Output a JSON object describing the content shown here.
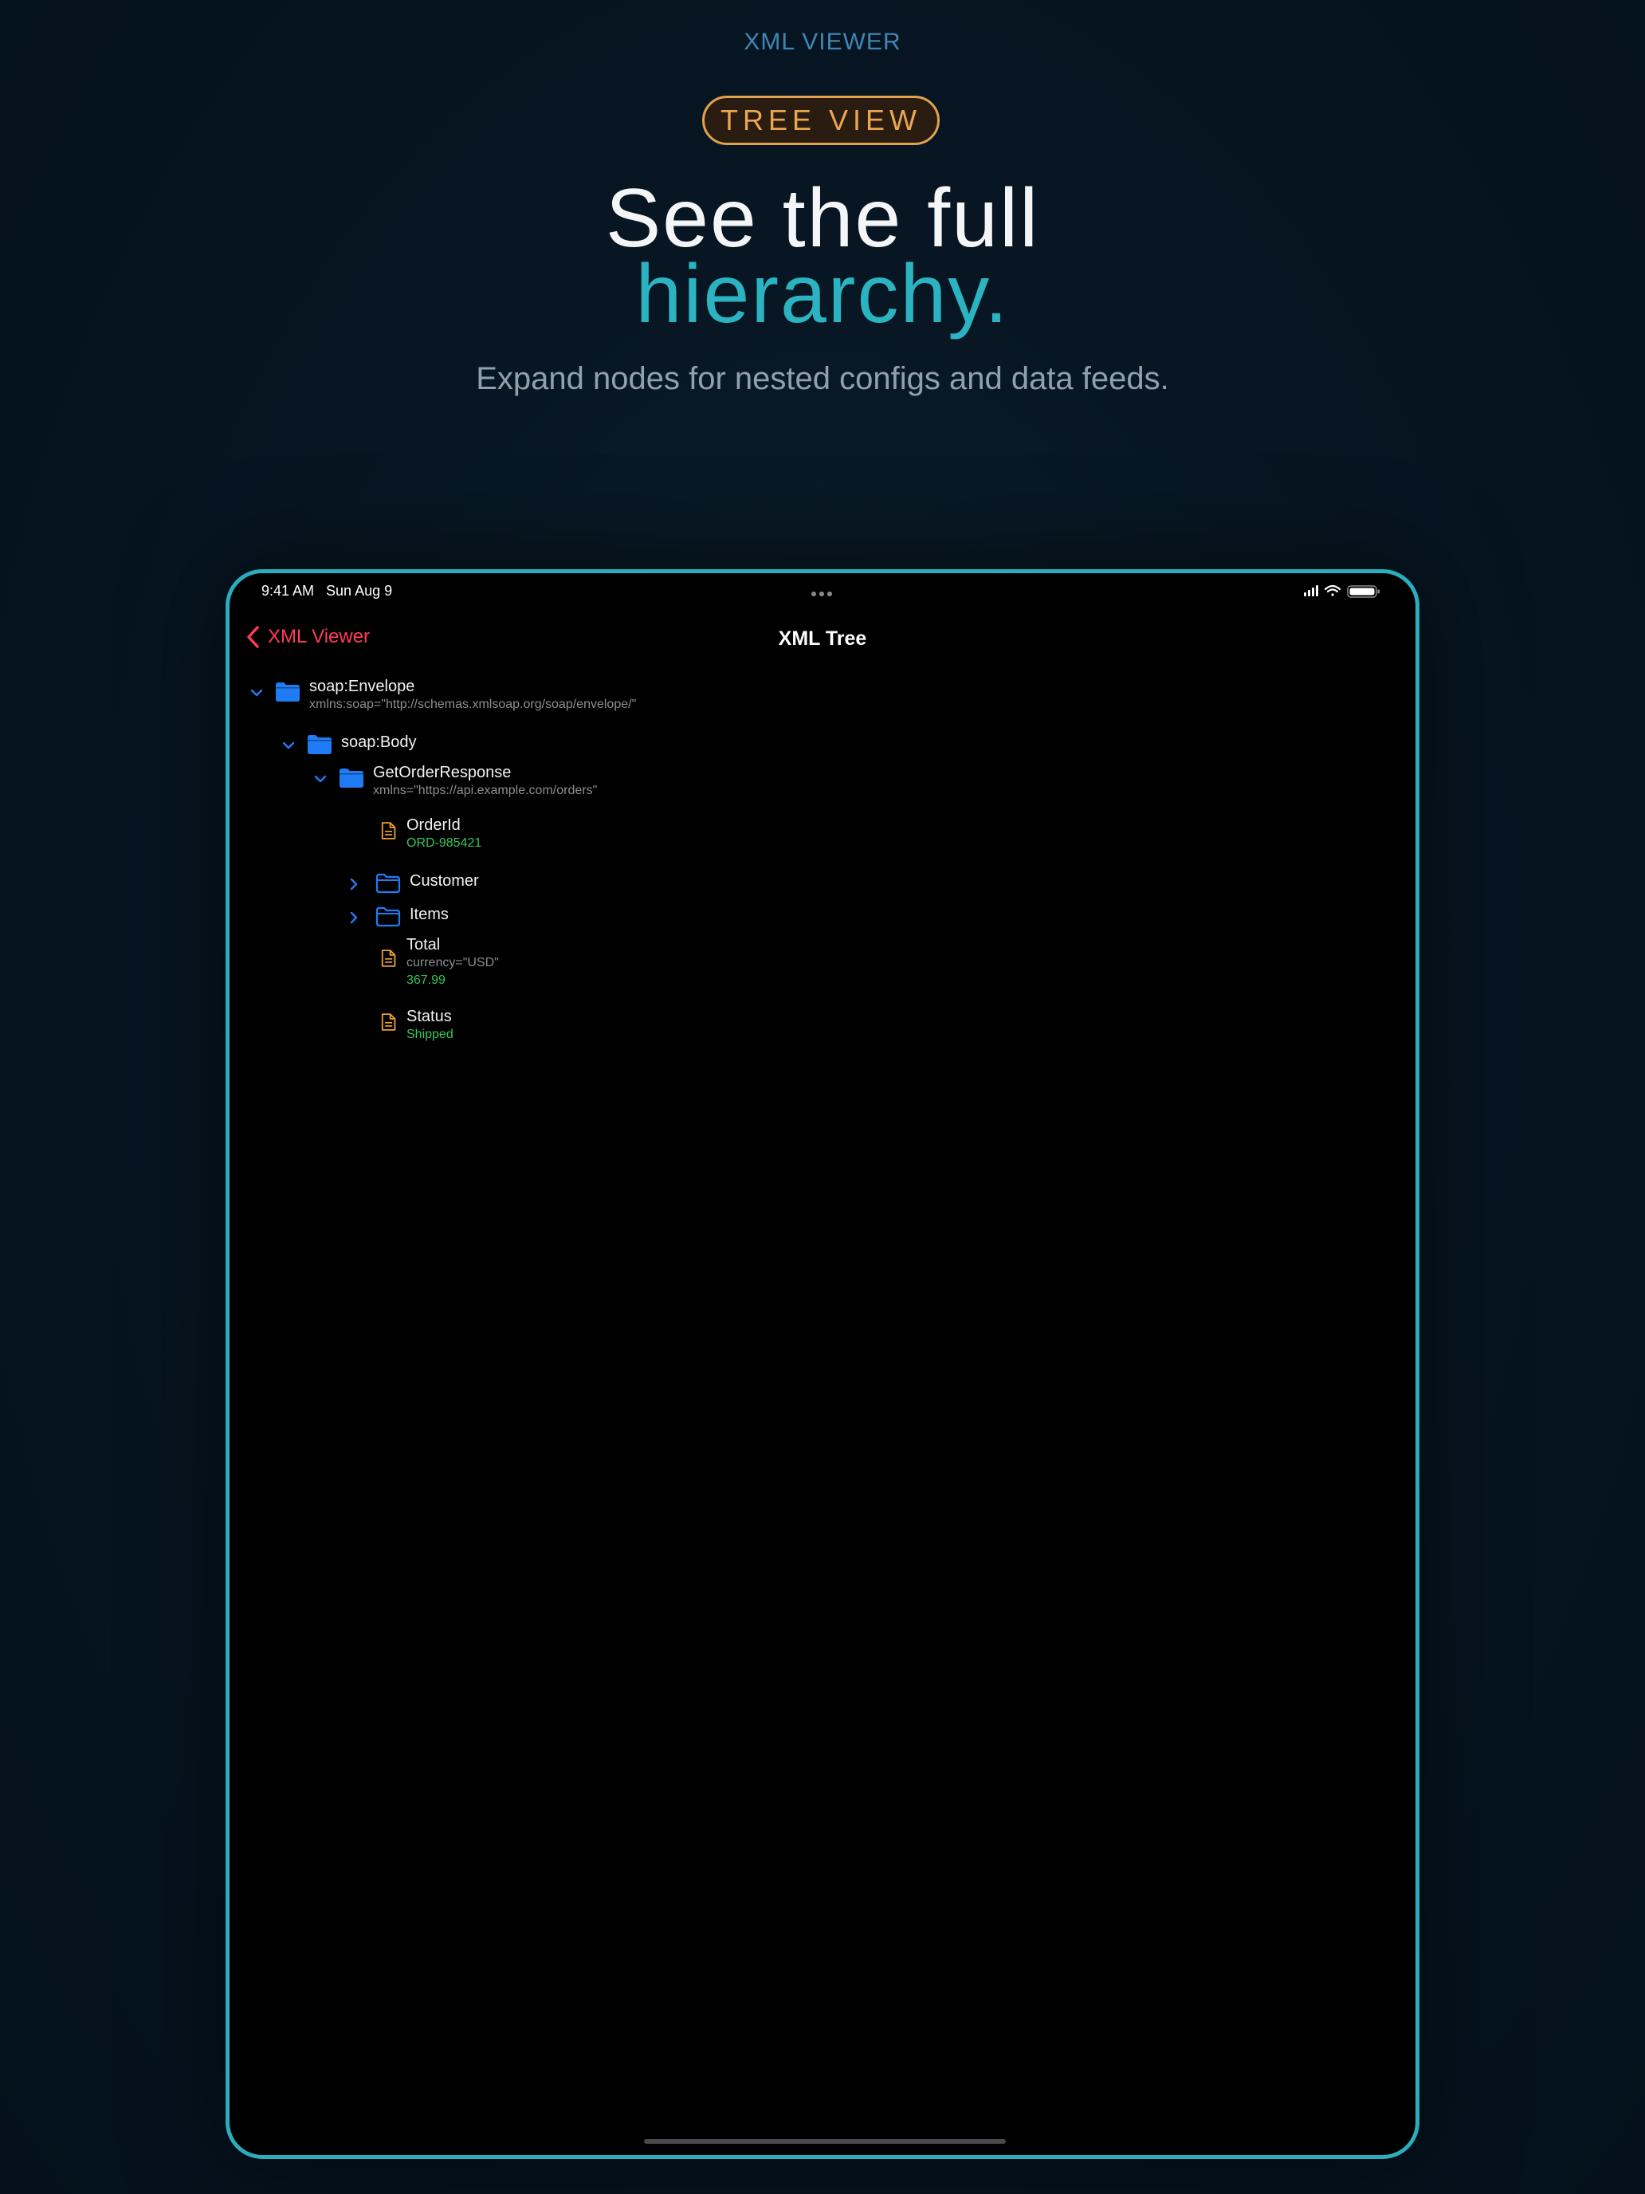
{
  "marketing": {
    "eyebrow": "XML VIEWER",
    "badge": "TREE VIEW",
    "headline_line1": "See the full",
    "headline_line2": "hierarchy.",
    "subtitle": "Expand nodes for nested configs and data feeds."
  },
  "status_bar": {
    "time_date": "9:41 AM   Sun Aug 9"
  },
  "nav": {
    "back_label": "XML Viewer",
    "title": "XML Tree"
  },
  "tree": {
    "envelope": {
      "name": "soap:Envelope",
      "attr": "xmlns:soap=\"http://schemas.xmlsoap.org/soap/envelope/\"",
      "expanded": true
    },
    "body": {
      "name": "soap:Body",
      "expanded": true
    },
    "response": {
      "name": "GetOrderResponse",
      "attr": "xmlns=\"https://api.example.com/orders\"",
      "expanded": true
    },
    "order_id": {
      "name": "OrderId",
      "value": "ORD-985421"
    },
    "customer": {
      "name": "Customer",
      "expanded": false
    },
    "items": {
      "name": "Items",
      "expanded": false
    },
    "total": {
      "name": "Total",
      "attr": "currency=\"USD\"",
      "value": "367.99"
    },
    "status": {
      "name": "Status",
      "value": "Shipped"
    }
  },
  "colors": {
    "accent_teal": "#2aaebd",
    "badge_orange": "#e2a24a",
    "back_red": "#ff3b55",
    "folder_blue": "#1f7cf5",
    "leaf_orange": "#f0a030",
    "value_green": "#34c759"
  },
  "icons": [
    "chevron-left-icon",
    "chevron-down-icon",
    "chevron-right-icon",
    "folder-filled-icon",
    "folder-outline-icon",
    "document-icon",
    "signal-icon",
    "wifi-icon",
    "battery-icon",
    "more-dots-icon"
  ]
}
